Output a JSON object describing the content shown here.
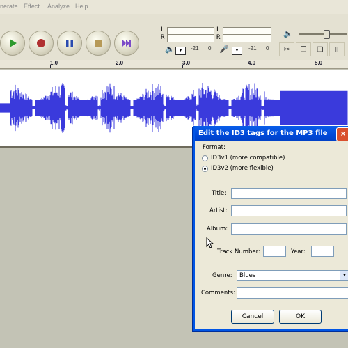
{
  "menubar": {
    "items": [
      "nerate",
      "Effect",
      "Analyze",
      "Help"
    ]
  },
  "meters": {
    "left_label": "L",
    "right_label": "R",
    "db_play": "-21",
    "db_play_zero": "0",
    "db_rec": "-21",
    "db_rec_zero": "0"
  },
  "ruler": {
    "ticks": [
      "1.0",
      "2.0",
      "3.0",
      "4.0",
      "5.0"
    ]
  },
  "dialog": {
    "title": "Edit the ID3 tags for the MP3 file",
    "close_label": "×",
    "format_label": "Format:",
    "id3v1_label": "ID3v1 (more compatible)",
    "id3v2_label": "ID3v2 (more flexible)",
    "selected_format": "ID3v2",
    "title_label": "Title:",
    "title_value": "",
    "artist_label": "Artist:",
    "artist_value": "",
    "album_label": "Album:",
    "album_value": "",
    "track_label": "Track Number:",
    "track_value": "",
    "year_label": "Year:",
    "year_value": "",
    "genre_label": "Genre:",
    "genre_value": "Blues",
    "comments_label": "Comments:",
    "comments_value": "",
    "cancel_label": "Cancel",
    "ok_label": "OK"
  },
  "colors": {
    "waveform": "#3a3adc",
    "titlebar": "#0a5ee9",
    "play_green": "#2e9a2e",
    "record_red": "#b03030",
    "pause_blue": "#2a4bb0",
    "stop_tan": "#b79a58",
    "skip_purple": "#7c4cc8"
  },
  "icons": {
    "play": "play-icon",
    "record": "record-icon",
    "pause": "pause-icon",
    "stop": "stop-icon",
    "skip_end": "skip-end-icon",
    "speaker": "speaker-icon",
    "microphone": "microphone-icon",
    "cursor": "arrow-cursor"
  }
}
